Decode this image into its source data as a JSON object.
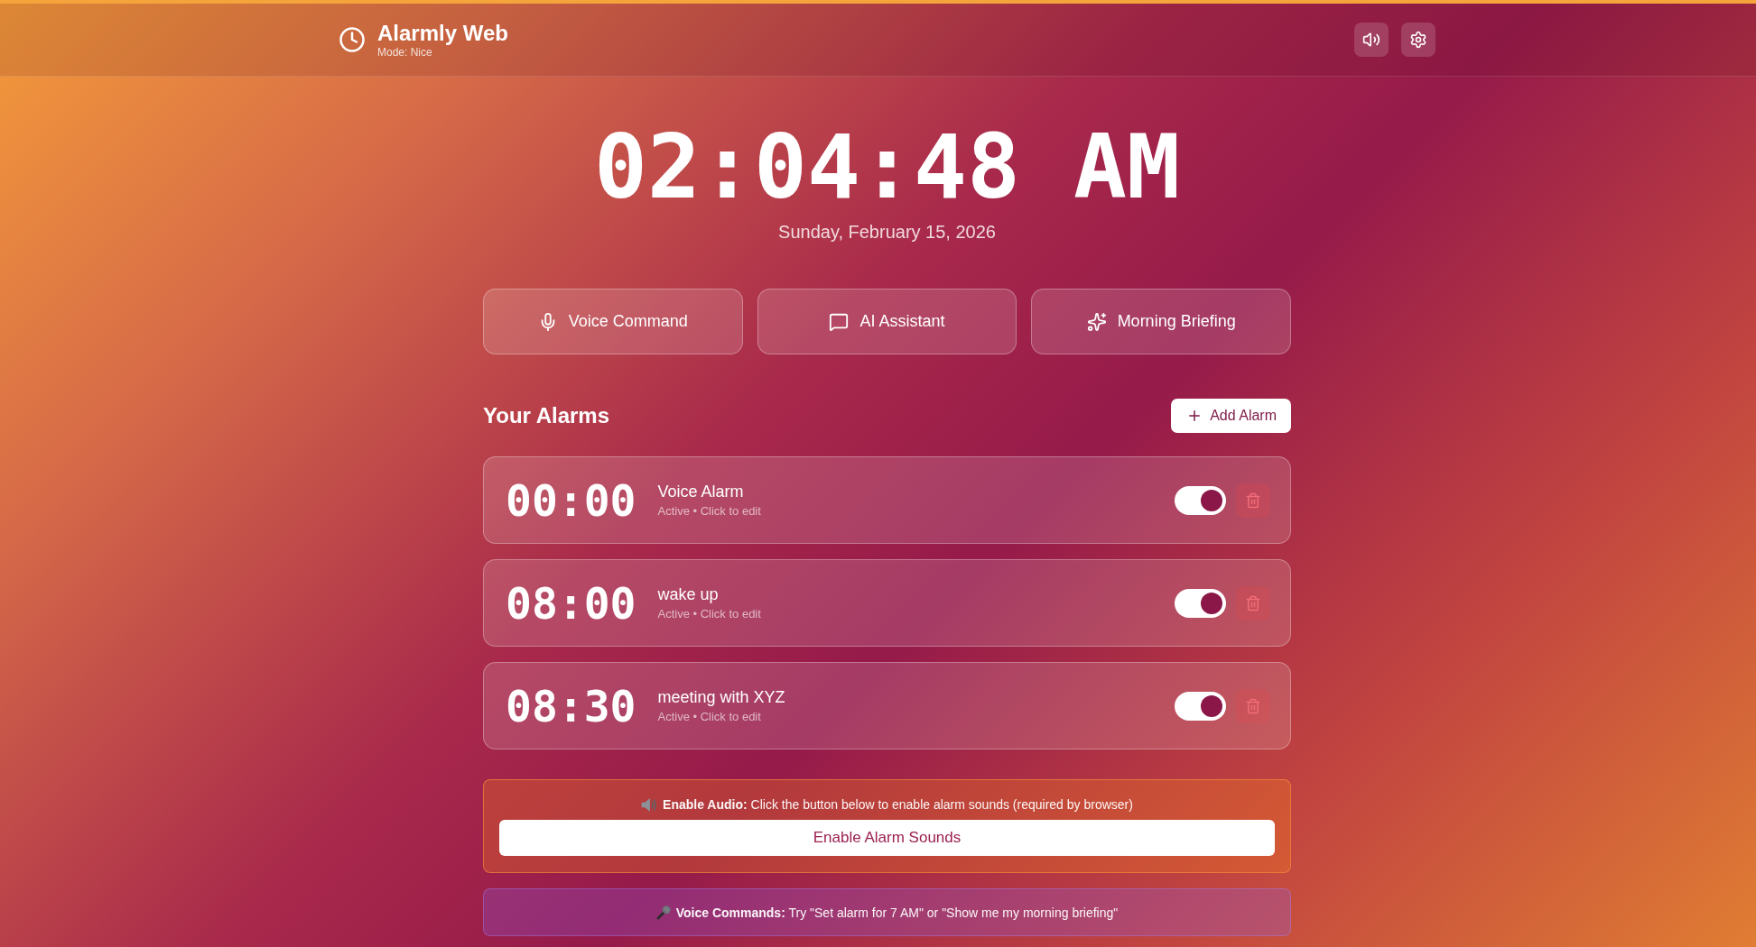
{
  "header": {
    "title": "Alarmly Web",
    "subtitle": "Mode: Nice"
  },
  "clock": {
    "time": "02:04:48 AM",
    "date": "Sunday, February 15, 2026"
  },
  "actions": [
    {
      "kind": "voice",
      "label": "Voice Command"
    },
    {
      "kind": "chat",
      "label": "AI Assistant"
    },
    {
      "kind": "briefing",
      "label": "Morning Briefing"
    }
  ],
  "alarms_section": {
    "title": "Your Alarms",
    "add_button": "Add Alarm"
  },
  "alarms": [
    {
      "time": "00:00",
      "label": "Voice Alarm",
      "status": "Active • Click to edit",
      "on": true
    },
    {
      "time": "08:00",
      "label": "wake up",
      "status": "Active • Click to edit",
      "on": true
    },
    {
      "time": "08:30",
      "label": "meeting with XYZ",
      "status": "Active • Click to edit",
      "on": true
    }
  ],
  "audio_notice": {
    "text": "**Enable Audio:** Click the button below to enable alarm sounds (required by browser)",
    "button": "Enable Alarm Sounds"
  },
  "voice_tip": {
    "text": "**Voice Commands:** Try \"Set alarm for 7 AM\" or \"Show me my morning briefing\""
  }
}
